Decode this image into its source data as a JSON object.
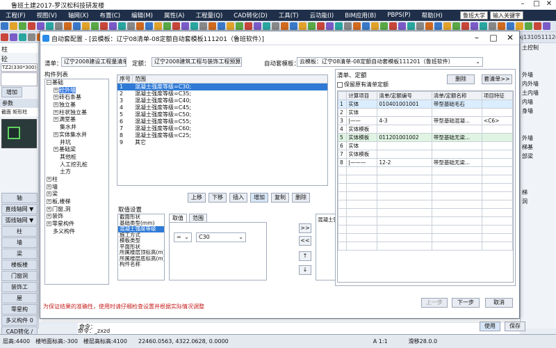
{
  "app": {
    "title": "鲁班土建2017-罗汉松科技研发楼",
    "menu": [
      "工程(F)",
      "视图(V)",
      "轴网(X)",
      "布置(C)",
      "编辑(M)",
      "属性(A)",
      "工程量(Q)",
      "CAD转化(D)",
      "工具(T)",
      "云功能(I)",
      "BIM应用(B)",
      "PBPS(P)",
      "帮助(H)"
    ],
    "menu_right": [
      "鲁班大学",
      "输入关键字"
    ],
    "user": "zxj1310511126"
  },
  "left_panel": {
    "top_label": "柱",
    "top_label2": "砼",
    "code_field": "TZ2(330*300)",
    "add_button": "增加",
    "param_header": "参数",
    "param_row1": "截面 矩形柱",
    "axis_tab": "轴",
    "buttons": [
      "直线轴网 ▼",
      "弧线轴网 ▼",
      "柱",
      "墙",
      "梁",
      "楼板楼",
      "门窗洞",
      "装饰工",
      "屋",
      "零星构",
      "多义构件 0",
      "CAD转化 /"
    ]
  },
  "right_panel": {
    "items": [
      "土控制",
      "",
      "",
      "外墙",
      "内外墙",
      "土内墙",
      "内墙",
      "身墙",
      "",
      "",
      "外墙",
      "梯基",
      "部梁",
      "",
      "",
      "",
      "梯",
      "洞",
      "",
      "",
      "",
      "",
      ""
    ]
  },
  "dialog": {
    "title": "自动套配置 - [云模板：辽宁08清单-08定额自动套模板111201（鲁班软件）]",
    "qingdan_label": "清单：",
    "qingdan_value": "辽宁2008建设工程量清单",
    "dinge_label": "定额：",
    "dinge_value": "辽宁2008建筑工程与装饰工程预算定额3",
    "template_label": "自动套模板：",
    "template_value": "云模板：辽宁08清单-08定额自动套模板111201（鲁班软件）",
    "component_list_label": "构件列表",
    "tree": [
      {
        "indent": 0,
        "exp": "−",
        "text": "基础",
        "sel": false
      },
      {
        "indent": 1,
        "exp": "+",
        "text": "砼外墙",
        "sel": true
      },
      {
        "indent": 1,
        "exp": "+",
        "text": "砖石条基",
        "sel": false
      },
      {
        "indent": 1,
        "exp": "+",
        "text": "独立基",
        "sel": false
      },
      {
        "indent": 1,
        "exp": "+",
        "text": "柱状独立基",
        "sel": false
      },
      {
        "indent": 1,
        "exp": "+",
        "text": "满堂基",
        "sel": false
      },
      {
        "indent": 1,
        "exp": "",
        "text": "集水井",
        "sel": false
      },
      {
        "indent": 1,
        "exp": "+",
        "text": "实体集水井",
        "sel": false
      },
      {
        "indent": 1,
        "exp": "",
        "text": "井坑",
        "sel": false
      },
      {
        "indent": 1,
        "exp": "+",
        "text": "基础梁",
        "sel": false
      },
      {
        "indent": 1,
        "exp": "",
        "text": "其他桩",
        "sel": false
      },
      {
        "indent": 1,
        "exp": "",
        "text": "人工挖孔桩",
        "sel": false
      },
      {
        "indent": 1,
        "exp": "",
        "text": "土方",
        "sel": false
      },
      {
        "indent": 0,
        "exp": "+",
        "text": "柱",
        "sel": false
      },
      {
        "indent": 0,
        "exp": "+",
        "text": "墙",
        "sel": false
      },
      {
        "indent": 0,
        "exp": "+",
        "text": "梁",
        "sel": false
      },
      {
        "indent": 0,
        "exp": "+",
        "text": "板,楼梯",
        "sel": false
      },
      {
        "indent": 0,
        "exp": "+",
        "text": "门窗,洞",
        "sel": false
      },
      {
        "indent": 0,
        "exp": "+",
        "text": "装饰",
        "sel": false
      },
      {
        "indent": 0,
        "exp": "+",
        "text": "零星构件",
        "sel": false
      },
      {
        "indent": 0,
        "exp": "",
        "text": "多义构件",
        "sel": false
      }
    ],
    "range_grid": {
      "headers": [
        "序号",
        "范围"
      ],
      "rows": [
        {
          "no": "1",
          "text": "混凝土强度等级=C30;",
          "sel": true
        },
        {
          "no": "2",
          "text": "混凝土强度等级=C35;",
          "sel": false
        },
        {
          "no": "3",
          "text": "混凝土强度等级=C40;",
          "sel": false
        },
        {
          "no": "4",
          "text": "混凝土强度等级=C45;",
          "sel": false
        },
        {
          "no": "5",
          "text": "混凝土强度等级=C50;",
          "sel": false
        },
        {
          "no": "6",
          "text": "混凝土强度等级=C55;",
          "sel": false
        },
        {
          "no": "7",
          "text": "混凝土强度等级=C60;",
          "sel": false
        },
        {
          "no": "8",
          "text": "混凝土强度等级=C25;",
          "sel": false
        },
        {
          "no": "9",
          "text": "其它",
          "sel": false
        }
      ]
    },
    "range_buttons": [
      "上移",
      "下移",
      "插入",
      "增加",
      "复制",
      "删除"
    ],
    "settings": {
      "label": "取值设置",
      "list": [
        "截面形状",
        "基础类型(mm)",
        "混凝土强度等级",
        "施工方式",
        "模板类型",
        "平面形状",
        "所属楼层顶标高(m)",
        "所属楼层底标高(m)",
        "构件名称"
      ],
      "selected_index": 2,
      "tabs": [
        "取值",
        "范围"
      ],
      "operator": "=",
      "value": "C30",
      "arrows": [
        ">>",
        "<<",
        "↑",
        "↓"
      ],
      "result": "混凝土强度等级=C30"
    },
    "quota": {
      "label": "清单、定额",
      "keep_checkbox_label": "保留原有清单定额",
      "delete_button": "删除",
      "set_button": "套清单>>",
      "headers": [
        "",
        "计算项目",
        "清单/定额编号",
        "清单/定额名称",
        "项目特征"
      ],
      "rows": [
        {
          "no": "1",
          "item": "实体",
          "code": "010401001001",
          "name": "带型基础毛石",
          "feature": "",
          "style": "hl"
        },
        {
          "no": "2",
          "item": "实体",
          "code": "",
          "name": "",
          "feature": "",
          "style": ""
        },
        {
          "no": "3",
          "item": "|——",
          "code": "4-3",
          "name": "带型基础混凝...",
          "feature": "<C6>",
          "style": ""
        },
        {
          "no": "4",
          "item": "实体模板",
          "code": "",
          "name": "",
          "feature": "",
          "style": ""
        },
        {
          "no": "5",
          "item": "实体模板",
          "code": "011201001002",
          "name": "带型基础无梁...",
          "feature": "",
          "style": "hl2"
        },
        {
          "no": "6",
          "item": "实体",
          "code": "",
          "name": "",
          "feature": "",
          "style": ""
        },
        {
          "no": "7",
          "item": "实体模板",
          "code": "",
          "name": "",
          "feature": "",
          "style": ""
        },
        {
          "no": "8",
          "item": "|———",
          "code": "12-2",
          "name": "带型基础无梁...",
          "feature": "",
          "style": ""
        }
      ]
    },
    "warning": "为保证结果的准确性，使用时请仔细检查设置并根据实际情况调整",
    "footer_buttons": [
      "上一步",
      "下一步",
      "取消"
    ]
  },
  "bottom": {
    "cmd1": "命令：",
    "cmd2": "命令：_zxzd",
    "status": [
      "层高:4400",
      "楼地面标高:-300",
      "楼层高标高:4100",
      "22460.0563, 4322.0628, 0.0000",
      "A 1:1",
      "滑移28.0.0"
    ],
    "right_buttons": [
      "使用",
      "保存"
    ]
  },
  "colors": {
    "menubar": "#1f2f49",
    "accent": "#2e7ad6",
    "warning": "#c5221f"
  }
}
